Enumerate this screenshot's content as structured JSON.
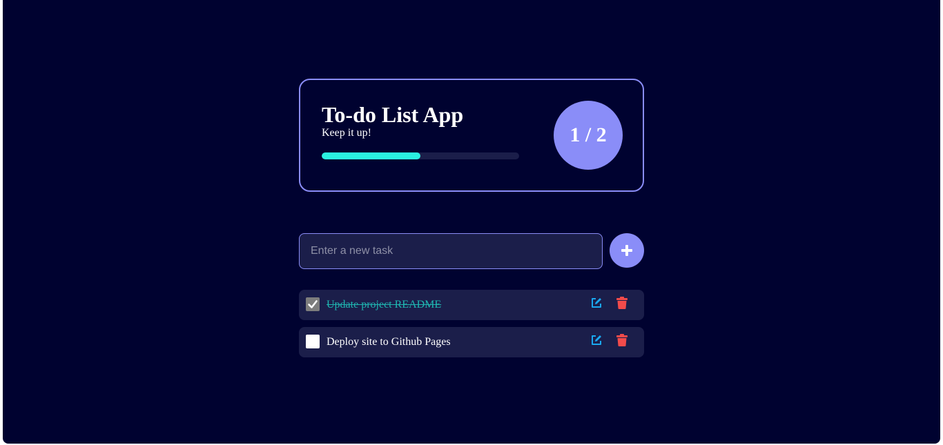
{
  "app": {
    "title": "To-do List App",
    "subtitle": "Keep it up!",
    "progress_fraction": 0.5,
    "completed": 1,
    "total": 2,
    "count_label": "1 / 2"
  },
  "form": {
    "placeholder": "Enter a new task",
    "value": "",
    "add_icon": "plus-icon"
  },
  "tasks": [
    {
      "text": "Update project README",
      "done": true
    },
    {
      "text": "Deploy site to Github Pages",
      "done": false
    }
  ],
  "icons": {
    "edit": "edit-icon",
    "delete": "trash-icon",
    "check": "checkmark-icon"
  },
  "colors": {
    "background": "#000230",
    "accent": "#8a8df8",
    "progress": "#2af2e0",
    "card": "#1b1e4a",
    "edit_icon": "#1aa8f0",
    "delete_icon": "#f24b4b",
    "done_text": "#1fb5b0"
  }
}
